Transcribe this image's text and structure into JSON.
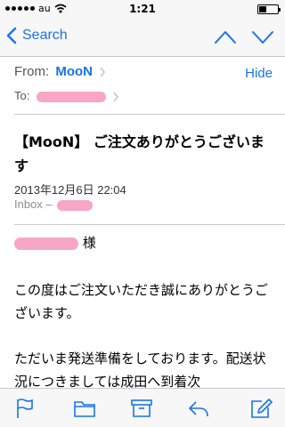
{
  "status_bar": {
    "carrier": "au",
    "time": "1:21"
  },
  "nav": {
    "back_label": "Search"
  },
  "header": {
    "from_label": "From:",
    "sender": "MooN",
    "hide_label": "Hide",
    "to_label": "To:"
  },
  "message": {
    "subject": "【MooN】 ご注文ありがとうございます",
    "date": "2013年12月6日 22:04",
    "mailbox": "Inbox –"
  },
  "body": {
    "honorific": "様",
    "paragraph1": "この度はご注文いただき誠にありがとうございます。",
    "paragraph2": "ただいま発送準備をしております。配送状況につきましては成田へ到着次"
  },
  "colors": {
    "accent": "#1a73e8",
    "redaction": "#f7a6c6"
  },
  "toolbar": {
    "icons": [
      "flag-icon",
      "folder-icon",
      "archive-icon",
      "reply-icon",
      "compose-icon"
    ]
  }
}
